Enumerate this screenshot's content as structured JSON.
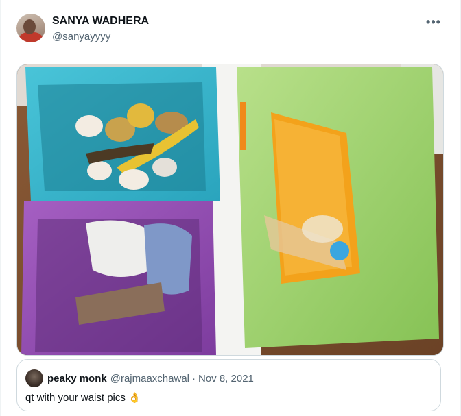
{
  "tweet": {
    "author": {
      "display_name": "SANYA WADHERA",
      "handle": "@sanyayyyy"
    },
    "more_icon": "more-icon",
    "media": {
      "description_icon": "photo"
    }
  },
  "quoted_tweet": {
    "author": {
      "display_name": "peaky monk",
      "handle": "@rajmaaxchawal"
    },
    "separator": "·",
    "date": "Nov 8, 2021",
    "text": "qt with your waist pics",
    "emoji": "👌"
  },
  "colors": {
    "text_primary": "#0f1419",
    "text_secondary": "#536471",
    "border": "#cfd9de"
  }
}
